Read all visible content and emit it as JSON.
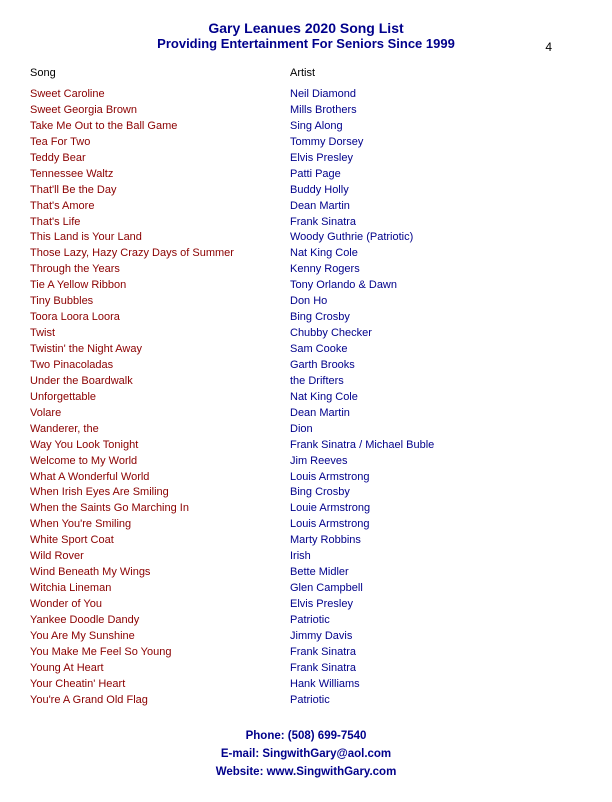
{
  "header": {
    "title": "Gary Leanues 2020 Song List",
    "subtitle": "Providing Entertainment For Seniors Since 1999",
    "page_number": "4"
  },
  "columns": {
    "song": "Song",
    "artist": "Artist"
  },
  "songs": [
    {
      "song": "Sweet Caroline",
      "artist": "Neil Diamond"
    },
    {
      "song": "Sweet Georgia Brown",
      "artist": "Mills Brothers"
    },
    {
      "song": "Take Me Out to the Ball Game",
      "artist": "Sing Along"
    },
    {
      "song": "Tea For Two",
      "artist": "Tommy Dorsey"
    },
    {
      "song": "Teddy Bear",
      "artist": "Elvis Presley"
    },
    {
      "song": "Tennessee Waltz",
      "artist": "Patti Page"
    },
    {
      "song": "That'll Be the Day",
      "artist": "Buddy Holly"
    },
    {
      "song": "That's Amore",
      "artist": "Dean Martin"
    },
    {
      "song": "That's Life",
      "artist": "Frank Sinatra"
    },
    {
      "song": "This Land is Your Land",
      "artist": "Woody Guthrie (Patriotic)"
    },
    {
      "song": "Those Lazy, Hazy Crazy Days of Summer",
      "artist": "Nat King Cole"
    },
    {
      "song": "Through the Years",
      "artist": "Kenny Rogers"
    },
    {
      "song": "Tie A Yellow Ribbon",
      "artist": "Tony Orlando & Dawn"
    },
    {
      "song": "Tiny Bubbles",
      "artist": "Don Ho"
    },
    {
      "song": "Toora Loora Loora",
      "artist": "Bing Crosby"
    },
    {
      "song": "Twist",
      "artist": "Chubby Checker"
    },
    {
      "song": "Twistin' the Night Away",
      "artist": "Sam Cooke"
    },
    {
      "song": "Two Pinacoladas",
      "artist": "Garth Brooks"
    },
    {
      "song": "Under the Boardwalk",
      "artist": "the Drifters"
    },
    {
      "song": "Unforgettable",
      "artist": "Nat King Cole"
    },
    {
      "song": "Volare",
      "artist": "Dean Martin"
    },
    {
      "song": "Wanderer, the",
      "artist": "Dion"
    },
    {
      "song": "Way You Look Tonight",
      "artist": "Frank Sinatra / Michael Buble"
    },
    {
      "song": "Welcome to My World",
      "artist": "Jim Reeves"
    },
    {
      "song": "What A Wonderful World",
      "artist": "Louis Armstrong"
    },
    {
      "song": "When Irish Eyes Are Smiling",
      "artist": "Bing Crosby"
    },
    {
      "song": "When the Saints Go Marching In",
      "artist": "Louie Armstrong"
    },
    {
      "song": "When You're Smiling",
      "artist": "Louis Armstrong"
    },
    {
      "song": "White Sport Coat",
      "artist": "Marty Robbins"
    },
    {
      "song": "Wild Rover",
      "artist": "Irish"
    },
    {
      "song": "Wind Beneath My Wings",
      "artist": "Bette Midler"
    },
    {
      "song": "Witchia Lineman",
      "artist": "Glen Campbell"
    },
    {
      "song": "Wonder of You",
      "artist": "Elvis Presley"
    },
    {
      "song": "Yankee Doodle Dandy",
      "artist": "Patriotic"
    },
    {
      "song": "You Are My Sunshine",
      "artist": "Jimmy Davis"
    },
    {
      "song": "You Make Me Feel So Young",
      "artist": "Frank Sinatra"
    },
    {
      "song": "Young At Heart",
      "artist": "Frank Sinatra"
    },
    {
      "song": "Your Cheatin' Heart",
      "artist": "Hank Williams"
    },
    {
      "song": "You're A Grand Old Flag",
      "artist": "Patriotic"
    }
  ],
  "footer": {
    "phone": "Phone: (508) 699-7540",
    "email": "E-mail: SingwithGary@aol.com",
    "website": "Website: www.SingwithGary.com"
  }
}
